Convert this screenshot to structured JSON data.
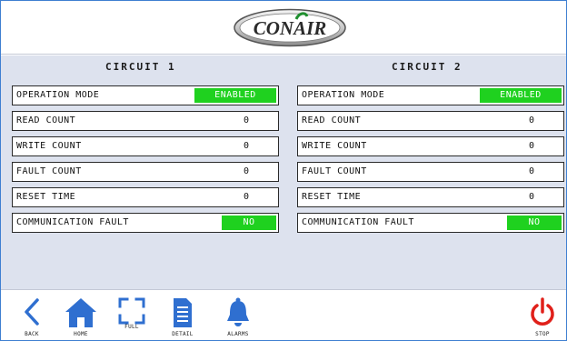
{
  "header": {
    "logo_text": "CONAIR"
  },
  "circuits": [
    {
      "title": "CIRCUIT 1",
      "operation_mode": {
        "label": "OPERATION MODE",
        "value": "ENABLED"
      },
      "read_count": {
        "label": "READ COUNT",
        "value": "0"
      },
      "write_count": {
        "label": "WRITE COUNT",
        "value": "0"
      },
      "fault_count": {
        "label": "FAULT COUNT",
        "value": "0"
      },
      "reset_time": {
        "label": "RESET TIME",
        "value": "0"
      },
      "communication_fault": {
        "label": "COMMUNICATION FAULT",
        "value": "NO"
      }
    },
    {
      "title": "CIRCUIT 2",
      "operation_mode": {
        "label": "OPERATION MODE",
        "value": "ENABLED"
      },
      "read_count": {
        "label": "READ COUNT",
        "value": "0"
      },
      "write_count": {
        "label": "WRITE COUNT",
        "value": "0"
      },
      "fault_count": {
        "label": "FAULT COUNT",
        "value": "0"
      },
      "reset_time": {
        "label": "RESET TIME",
        "value": "0"
      },
      "communication_fault": {
        "label": "COMMUNICATION FAULT",
        "value": "NO"
      }
    }
  ],
  "footer": {
    "back": {
      "label": "BACK",
      "icon": "chevron-left-icon"
    },
    "home": {
      "label": "HOME",
      "icon": "home-icon"
    },
    "full": {
      "label": "FULL",
      "icon": "fullscreen-icon"
    },
    "detail": {
      "label": "DETAIL",
      "icon": "document-icon"
    },
    "alarms": {
      "label": "ALARMS",
      "icon": "bell-icon"
    },
    "stop": {
      "label": "STOP",
      "icon": "power-icon"
    }
  },
  "colors": {
    "accent_blue": "#2f6fd0",
    "status_green": "#1fd11f",
    "stop_red": "#e0201a",
    "panel_bg": "#dde2ee"
  }
}
